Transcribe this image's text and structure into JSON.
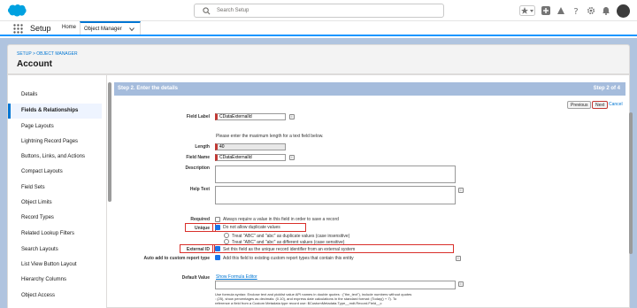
{
  "topbar": {
    "search_placeholder": "Search Setup"
  },
  "nav": {
    "app_name": "Setup",
    "tabs": [
      {
        "label": "Home"
      },
      {
        "label": "Object Manager"
      }
    ]
  },
  "header": {
    "breadcrumb_setup": "SETUP",
    "breadcrumb_sep": " > ",
    "breadcrumb_om": "OBJECT MANAGER",
    "title": "Account"
  },
  "sidebar": {
    "items": [
      {
        "label": "Details"
      },
      {
        "label": "Fields & Relationships"
      },
      {
        "label": "Page Layouts"
      },
      {
        "label": "Lightning Record Pages"
      },
      {
        "label": "Buttons, Links, and Actions"
      },
      {
        "label": "Compact Layouts"
      },
      {
        "label": "Field Sets"
      },
      {
        "label": "Object Limits"
      },
      {
        "label": "Record Types"
      },
      {
        "label": "Related Lookup Filters"
      },
      {
        "label": "Search Layouts"
      },
      {
        "label": "List View Button Layout"
      },
      {
        "label": "Hierarchy Columns"
      },
      {
        "label": "Object Access"
      }
    ]
  },
  "wizard": {
    "step_title": "Step 2. Enter the details",
    "step_count": "Step 2 of 4",
    "previous_label": "Previous",
    "next_label": "Next",
    "cancel_label": "Cancel",
    "field_label_label": "Field Label",
    "field_label_value": "CDataExternalId",
    "max_length_hint": "Please enter the maximum length for a text field below.",
    "length_label": "Length",
    "length_value": "40",
    "field_name_label": "Field Name",
    "field_name_value": "CDataExternalId",
    "description_label": "Description",
    "help_text_label": "Help Text",
    "required_label": "Required",
    "required_text": "Always require a value in this field in order to save a record",
    "unique_label": "Unique",
    "unique_text": "Do not allow duplicate values",
    "unique_opt1": "Treat \"ABC\" and \"abc\" as duplicate values (case insensitive)",
    "unique_opt2": "Treat \"ABC\" and \"abc\" as different values (case sensitive)",
    "external_id_label": "External ID",
    "external_id_text": "Set this field as the unique record identifier from an external system",
    "auto_add_label": "Auto add to custom report type",
    "auto_add_text": "Add this field to existing custom report types that contain this entity",
    "default_value_label": "Default Value",
    "formula_editor_link": "Show Formula Editor",
    "formula_help_1": "Use formula syntax: Enclose text and picklist value API names in double quotes : (\"the_text\"), include numbers without quotes",
    "formula_help_2": ": (25), show percentages as decimals: (0.10), and express date calculations in the standard format: (Today() + 7). To",
    "formula_help_3": "reference a field from a Custom Metadata type record use: $CustomMetadata.Type__mdt.Record.Field__c"
  }
}
